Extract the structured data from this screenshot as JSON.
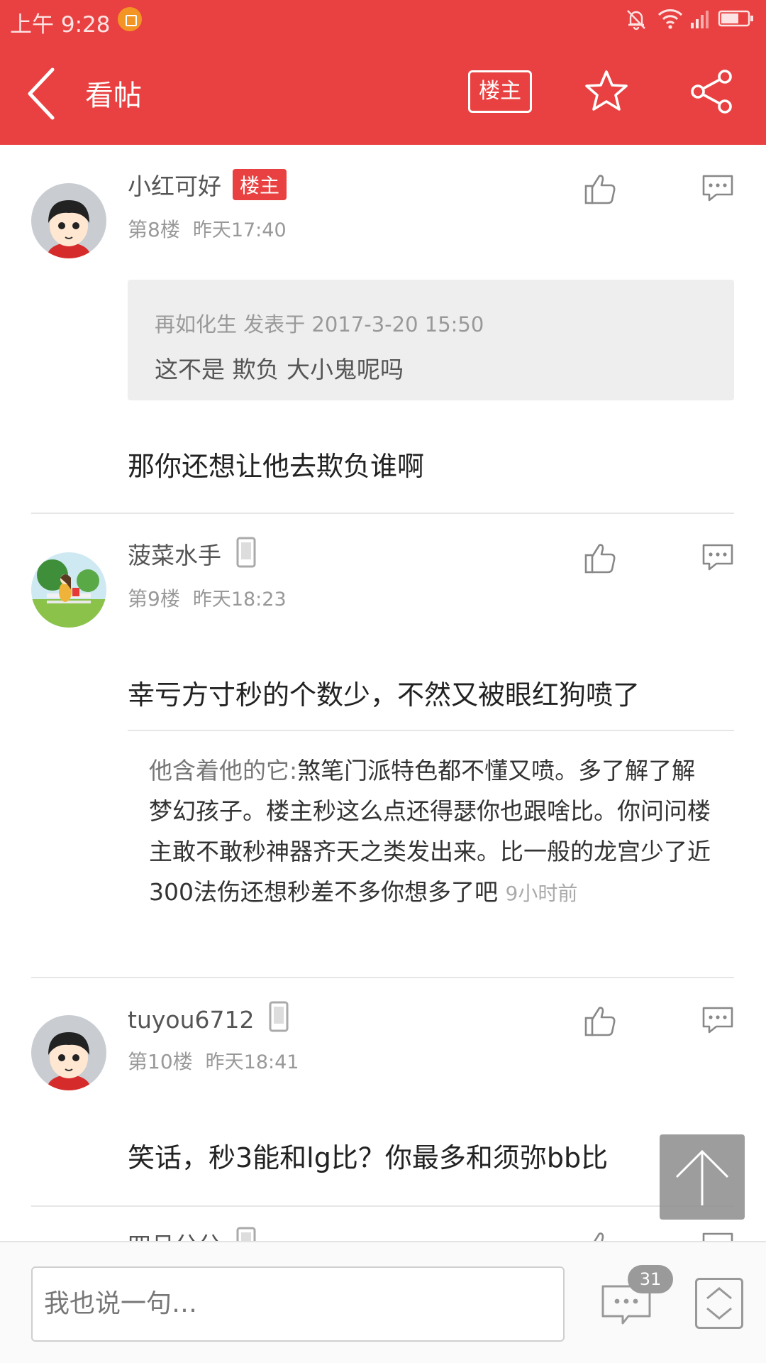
{
  "status_bar": {
    "time": "上午 9:28"
  },
  "header": {
    "title": "看帖",
    "owner_only_label": "楼主"
  },
  "posts": [
    {
      "username": "小红可好",
      "owner_badge": "楼主",
      "floor": "第8楼",
      "time": "昨天17:40",
      "quote": {
        "header": "再如化生 发表于 2017-3-20 15:50",
        "text": "这不是 欺负 大小鬼呢吗"
      },
      "content": "那你还想让他去欺负谁啊"
    },
    {
      "username": "菠菜水手",
      "floor": "第9楼",
      "time": "昨天18:23",
      "content": "幸亏方寸秒的个数少，不然又被眼红狗喷了",
      "sub_reply": {
        "author": "他含着他的它:",
        "text": "煞笔门派特色都不懂又喷。多了解了解梦幻孩子。楼主秒这么点还得瑟你也跟啥比。你问问楼主敢不敢秒神器齐天之类发出来。比一般的龙宫少了近300法伤还想秒差不多你想多了吧",
        "time": "9小时前"
      }
    },
    {
      "username": "tuyou6712",
      "floor": "第10楼",
      "time": "昨天18:41",
      "content": "笑话，秒3能和lg比？你最多和须弥bb比"
    },
    {
      "username": "四月分分"
    }
  ],
  "bottom_bar": {
    "input_placeholder": "我也说一句…",
    "comment_count": "31"
  },
  "colors": {
    "brand": "#e94141",
    "quote_bg": "#eeeeee"
  }
}
